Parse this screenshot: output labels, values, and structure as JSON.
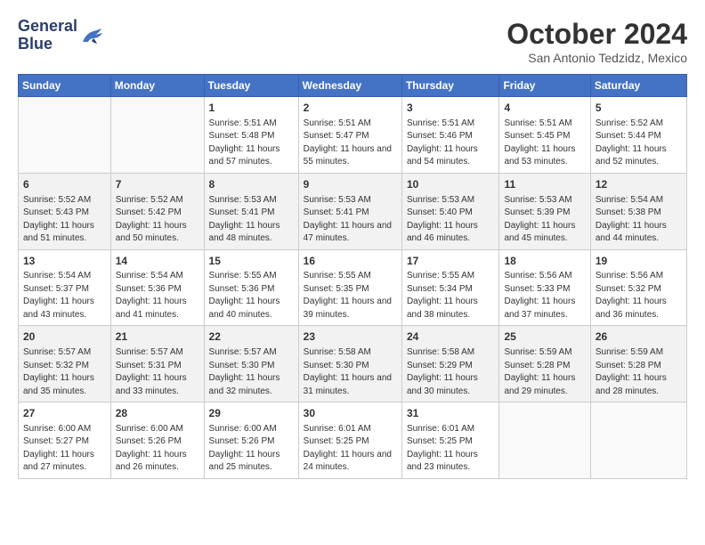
{
  "logo": {
    "line1": "General",
    "line2": "Blue"
  },
  "title": "October 2024",
  "location": "San Antonio Tedzidz, Mexico",
  "days_header": [
    "Sunday",
    "Monday",
    "Tuesday",
    "Wednesday",
    "Thursday",
    "Friday",
    "Saturday"
  ],
  "weeks": [
    [
      {
        "day": "",
        "sunrise": "",
        "sunset": "",
        "daylight": ""
      },
      {
        "day": "",
        "sunrise": "",
        "sunset": "",
        "daylight": ""
      },
      {
        "day": "1",
        "sunrise": "Sunrise: 5:51 AM",
        "sunset": "Sunset: 5:48 PM",
        "daylight": "Daylight: 11 hours and 57 minutes."
      },
      {
        "day": "2",
        "sunrise": "Sunrise: 5:51 AM",
        "sunset": "Sunset: 5:47 PM",
        "daylight": "Daylight: 11 hours and 55 minutes."
      },
      {
        "day": "3",
        "sunrise": "Sunrise: 5:51 AM",
        "sunset": "Sunset: 5:46 PM",
        "daylight": "Daylight: 11 hours and 54 minutes."
      },
      {
        "day": "4",
        "sunrise": "Sunrise: 5:51 AM",
        "sunset": "Sunset: 5:45 PM",
        "daylight": "Daylight: 11 hours and 53 minutes."
      },
      {
        "day": "5",
        "sunrise": "Sunrise: 5:52 AM",
        "sunset": "Sunset: 5:44 PM",
        "daylight": "Daylight: 11 hours and 52 minutes."
      }
    ],
    [
      {
        "day": "6",
        "sunrise": "Sunrise: 5:52 AM",
        "sunset": "Sunset: 5:43 PM",
        "daylight": "Daylight: 11 hours and 51 minutes."
      },
      {
        "day": "7",
        "sunrise": "Sunrise: 5:52 AM",
        "sunset": "Sunset: 5:42 PM",
        "daylight": "Daylight: 11 hours and 50 minutes."
      },
      {
        "day": "8",
        "sunrise": "Sunrise: 5:53 AM",
        "sunset": "Sunset: 5:41 PM",
        "daylight": "Daylight: 11 hours and 48 minutes."
      },
      {
        "day": "9",
        "sunrise": "Sunrise: 5:53 AM",
        "sunset": "Sunset: 5:41 PM",
        "daylight": "Daylight: 11 hours and 47 minutes."
      },
      {
        "day": "10",
        "sunrise": "Sunrise: 5:53 AM",
        "sunset": "Sunset: 5:40 PM",
        "daylight": "Daylight: 11 hours and 46 minutes."
      },
      {
        "day": "11",
        "sunrise": "Sunrise: 5:53 AM",
        "sunset": "Sunset: 5:39 PM",
        "daylight": "Daylight: 11 hours and 45 minutes."
      },
      {
        "day": "12",
        "sunrise": "Sunrise: 5:54 AM",
        "sunset": "Sunset: 5:38 PM",
        "daylight": "Daylight: 11 hours and 44 minutes."
      }
    ],
    [
      {
        "day": "13",
        "sunrise": "Sunrise: 5:54 AM",
        "sunset": "Sunset: 5:37 PM",
        "daylight": "Daylight: 11 hours and 43 minutes."
      },
      {
        "day": "14",
        "sunrise": "Sunrise: 5:54 AM",
        "sunset": "Sunset: 5:36 PM",
        "daylight": "Daylight: 11 hours and 41 minutes."
      },
      {
        "day": "15",
        "sunrise": "Sunrise: 5:55 AM",
        "sunset": "Sunset: 5:36 PM",
        "daylight": "Daylight: 11 hours and 40 minutes."
      },
      {
        "day": "16",
        "sunrise": "Sunrise: 5:55 AM",
        "sunset": "Sunset: 5:35 PM",
        "daylight": "Daylight: 11 hours and 39 minutes."
      },
      {
        "day": "17",
        "sunrise": "Sunrise: 5:55 AM",
        "sunset": "Sunset: 5:34 PM",
        "daylight": "Daylight: 11 hours and 38 minutes."
      },
      {
        "day": "18",
        "sunrise": "Sunrise: 5:56 AM",
        "sunset": "Sunset: 5:33 PM",
        "daylight": "Daylight: 11 hours and 37 minutes."
      },
      {
        "day": "19",
        "sunrise": "Sunrise: 5:56 AM",
        "sunset": "Sunset: 5:32 PM",
        "daylight": "Daylight: 11 hours and 36 minutes."
      }
    ],
    [
      {
        "day": "20",
        "sunrise": "Sunrise: 5:57 AM",
        "sunset": "Sunset: 5:32 PM",
        "daylight": "Daylight: 11 hours and 35 minutes."
      },
      {
        "day": "21",
        "sunrise": "Sunrise: 5:57 AM",
        "sunset": "Sunset: 5:31 PM",
        "daylight": "Daylight: 11 hours and 33 minutes."
      },
      {
        "day": "22",
        "sunrise": "Sunrise: 5:57 AM",
        "sunset": "Sunset: 5:30 PM",
        "daylight": "Daylight: 11 hours and 32 minutes."
      },
      {
        "day": "23",
        "sunrise": "Sunrise: 5:58 AM",
        "sunset": "Sunset: 5:30 PM",
        "daylight": "Daylight: 11 hours and 31 minutes."
      },
      {
        "day": "24",
        "sunrise": "Sunrise: 5:58 AM",
        "sunset": "Sunset: 5:29 PM",
        "daylight": "Daylight: 11 hours and 30 minutes."
      },
      {
        "day": "25",
        "sunrise": "Sunrise: 5:59 AM",
        "sunset": "Sunset: 5:28 PM",
        "daylight": "Daylight: 11 hours and 29 minutes."
      },
      {
        "day": "26",
        "sunrise": "Sunrise: 5:59 AM",
        "sunset": "Sunset: 5:28 PM",
        "daylight": "Daylight: 11 hours and 28 minutes."
      }
    ],
    [
      {
        "day": "27",
        "sunrise": "Sunrise: 6:00 AM",
        "sunset": "Sunset: 5:27 PM",
        "daylight": "Daylight: 11 hours and 27 minutes."
      },
      {
        "day": "28",
        "sunrise": "Sunrise: 6:00 AM",
        "sunset": "Sunset: 5:26 PM",
        "daylight": "Daylight: 11 hours and 26 minutes."
      },
      {
        "day": "29",
        "sunrise": "Sunrise: 6:00 AM",
        "sunset": "Sunset: 5:26 PM",
        "daylight": "Daylight: 11 hours and 25 minutes."
      },
      {
        "day": "30",
        "sunrise": "Sunrise: 6:01 AM",
        "sunset": "Sunset: 5:25 PM",
        "daylight": "Daylight: 11 hours and 24 minutes."
      },
      {
        "day": "31",
        "sunrise": "Sunrise: 6:01 AM",
        "sunset": "Sunset: 5:25 PM",
        "daylight": "Daylight: 11 hours and 23 minutes."
      },
      {
        "day": "",
        "sunrise": "",
        "sunset": "",
        "daylight": ""
      },
      {
        "day": "",
        "sunrise": "",
        "sunset": "",
        "daylight": ""
      }
    ]
  ]
}
